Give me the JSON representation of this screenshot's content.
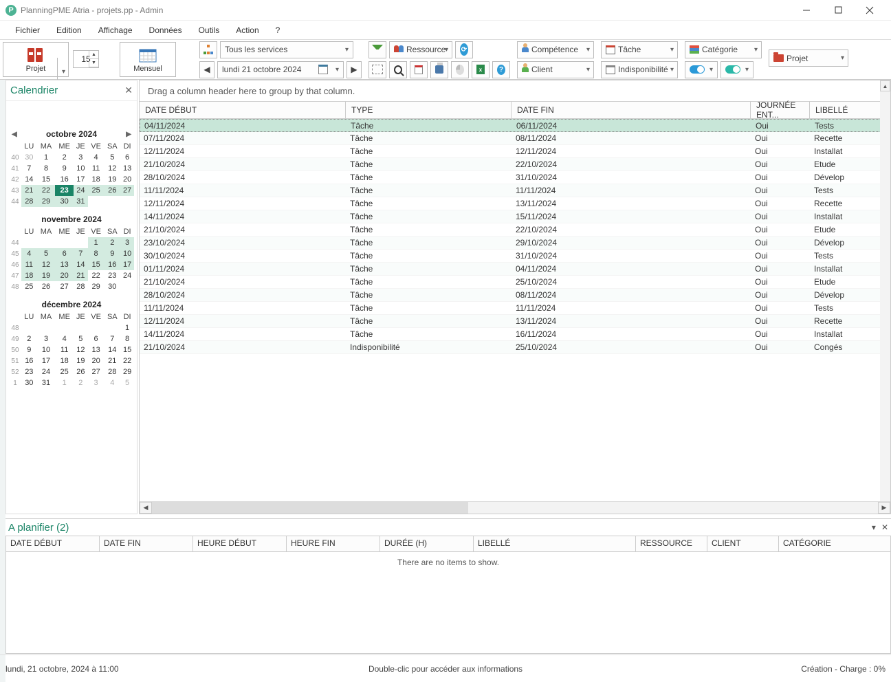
{
  "title": "PlanningPME Atria - projets.pp - Admin",
  "menu": [
    "Fichier",
    "Edition",
    "Affichage",
    "Données",
    "Outils",
    "Action",
    "?"
  ],
  "toolbar": {
    "projet": "Projet",
    "mensuel": "Mensuel",
    "num": "15",
    "service_combo": "Tous les services",
    "date_display": "lundi     21   octobre   2024",
    "ressource": "Ressource",
    "competence": "Compétence",
    "tache": "Tâche",
    "categorie": "Catégorie",
    "projet2": "Projet",
    "client": "Client",
    "indispo": "Indisponibilité"
  },
  "calendar_panel": {
    "title": "Calendrier",
    "months": [
      {
        "name": "octobre 2024",
        "nav": true,
        "dow": [
          "LU",
          "MA",
          "ME",
          "JE",
          "VE",
          "SA",
          "DI"
        ],
        "rows": [
          {
            "wk": "40",
            "days": [
              {
                "d": "30",
                "cls": "out"
              },
              {
                "d": "1"
              },
              {
                "d": "2"
              },
              {
                "d": "3"
              },
              {
                "d": "4"
              },
              {
                "d": "5"
              },
              {
                "d": "6"
              }
            ]
          },
          {
            "wk": "41",
            "days": [
              {
                "d": "7"
              },
              {
                "d": "8"
              },
              {
                "d": "9"
              },
              {
                "d": "10"
              },
              {
                "d": "11"
              },
              {
                "d": "12"
              },
              {
                "d": "13"
              }
            ]
          },
          {
            "wk": "42",
            "days": [
              {
                "d": "14"
              },
              {
                "d": "15"
              },
              {
                "d": "16"
              },
              {
                "d": "17"
              },
              {
                "d": "18"
              },
              {
                "d": "19"
              },
              {
                "d": "20"
              }
            ]
          },
          {
            "wk": "43",
            "days": [
              {
                "d": "21",
                "cls": "hl"
              },
              {
                "d": "22",
                "cls": "hl"
              },
              {
                "d": "23",
                "cls": "today"
              },
              {
                "d": "24",
                "cls": "hl"
              },
              {
                "d": "25",
                "cls": "hl"
              },
              {
                "d": "26",
                "cls": "hl"
              },
              {
                "d": "27",
                "cls": "hl"
              }
            ]
          },
          {
            "wk": "44",
            "days": [
              {
                "d": "28",
                "cls": "hl"
              },
              {
                "d": "29",
                "cls": "hl"
              },
              {
                "d": "30",
                "cls": "hl"
              },
              {
                "d": "31",
                "cls": "hl"
              },
              {
                "d": ""
              },
              {
                "d": ""
              },
              {
                "d": ""
              }
            ]
          }
        ]
      },
      {
        "name": "novembre 2024",
        "nav": false,
        "dow": [
          "LU",
          "MA",
          "ME",
          "JE",
          "VE",
          "SA",
          "DI"
        ],
        "rows": [
          {
            "wk": "44",
            "days": [
              {
                "d": ""
              },
              {
                "d": ""
              },
              {
                "d": ""
              },
              {
                "d": ""
              },
              {
                "d": "1",
                "cls": "hl"
              },
              {
                "d": "2",
                "cls": "hl"
              },
              {
                "d": "3",
                "cls": "hl"
              }
            ]
          },
          {
            "wk": "45",
            "days": [
              {
                "d": "4",
                "cls": "hl"
              },
              {
                "d": "5",
                "cls": "hl"
              },
              {
                "d": "6",
                "cls": "hl"
              },
              {
                "d": "7",
                "cls": "hl"
              },
              {
                "d": "8",
                "cls": "hl"
              },
              {
                "d": "9",
                "cls": "hl"
              },
              {
                "d": "10",
                "cls": "hl"
              }
            ]
          },
          {
            "wk": "46",
            "days": [
              {
                "d": "11",
                "cls": "hl"
              },
              {
                "d": "12",
                "cls": "hl"
              },
              {
                "d": "13",
                "cls": "hl"
              },
              {
                "d": "14",
                "cls": "hl"
              },
              {
                "d": "15",
                "cls": "hl"
              },
              {
                "d": "16",
                "cls": "hl"
              },
              {
                "d": "17",
                "cls": "hl"
              }
            ]
          },
          {
            "wk": "47",
            "days": [
              {
                "d": "18",
                "cls": "hl"
              },
              {
                "d": "19",
                "cls": "hl"
              },
              {
                "d": "20",
                "cls": "hl"
              },
              {
                "d": "21",
                "cls": "hl"
              },
              {
                "d": "22"
              },
              {
                "d": "23"
              },
              {
                "d": "24"
              }
            ]
          },
          {
            "wk": "48",
            "days": [
              {
                "d": "25"
              },
              {
                "d": "26"
              },
              {
                "d": "27"
              },
              {
                "d": "28"
              },
              {
                "d": "29"
              },
              {
                "d": "30"
              },
              {
                "d": ""
              }
            ]
          }
        ]
      },
      {
        "name": "décembre 2024",
        "nav": false,
        "dow": [
          "LU",
          "MA",
          "ME",
          "JE",
          "VE",
          "SA",
          "DI"
        ],
        "rows": [
          {
            "wk": "48",
            "days": [
              {
                "d": ""
              },
              {
                "d": ""
              },
              {
                "d": ""
              },
              {
                "d": ""
              },
              {
                "d": ""
              },
              {
                "d": ""
              },
              {
                "d": "1"
              }
            ]
          },
          {
            "wk": "49",
            "days": [
              {
                "d": "2"
              },
              {
                "d": "3"
              },
              {
                "d": "4"
              },
              {
                "d": "5"
              },
              {
                "d": "6"
              },
              {
                "d": "7"
              },
              {
                "d": "8"
              }
            ]
          },
          {
            "wk": "50",
            "days": [
              {
                "d": "9"
              },
              {
                "d": "10"
              },
              {
                "d": "11"
              },
              {
                "d": "12"
              },
              {
                "d": "13"
              },
              {
                "d": "14"
              },
              {
                "d": "15"
              }
            ]
          },
          {
            "wk": "51",
            "days": [
              {
                "d": "16"
              },
              {
                "d": "17"
              },
              {
                "d": "18"
              },
              {
                "d": "19"
              },
              {
                "d": "20"
              },
              {
                "d": "21"
              },
              {
                "d": "22"
              }
            ]
          },
          {
            "wk": "52",
            "days": [
              {
                "d": "23"
              },
              {
                "d": "24"
              },
              {
                "d": "25"
              },
              {
                "d": "26"
              },
              {
                "d": "27"
              },
              {
                "d": "28"
              },
              {
                "d": "29"
              }
            ]
          },
          {
            "wk": "1",
            "days": [
              {
                "d": "30"
              },
              {
                "d": "31"
              },
              {
                "d": "1",
                "cls": "out"
              },
              {
                "d": "2",
                "cls": "out"
              },
              {
                "d": "3",
                "cls": "out"
              },
              {
                "d": "4",
                "cls": "out"
              },
              {
                "d": "5",
                "cls": "out"
              }
            ]
          }
        ]
      }
    ]
  },
  "grid": {
    "hint": "Drag a column header here to group by that column.",
    "columns": [
      "DATE DÉBUT",
      "TYPE",
      "DATE FIN",
      "JOURNÉE ENT...",
      "LIBELLÉ"
    ],
    "rows": [
      {
        "sel": true,
        "cells": [
          "04/11/2024",
          "Tâche",
          "06/11/2024",
          "Oui",
          "Tests"
        ]
      },
      {
        "cells": [
          "07/11/2024",
          "Tâche",
          "08/11/2024",
          "Oui",
          "Recette"
        ]
      },
      {
        "cells": [
          "12/11/2024",
          "Tâche",
          "12/11/2024",
          "Oui",
          "Installat"
        ]
      },
      {
        "cells": [
          "21/10/2024",
          "Tâche",
          "22/10/2024",
          "Oui",
          "Etude"
        ]
      },
      {
        "cells": [
          "28/10/2024",
          "Tâche",
          "31/10/2024",
          "Oui",
          "Dévelop"
        ]
      },
      {
        "cells": [
          "11/11/2024",
          "Tâche",
          "11/11/2024",
          "Oui",
          "Tests"
        ]
      },
      {
        "cells": [
          "12/11/2024",
          "Tâche",
          "13/11/2024",
          "Oui",
          "Recette"
        ]
      },
      {
        "cells": [
          "14/11/2024",
          "Tâche",
          "15/11/2024",
          "Oui",
          "Installat"
        ]
      },
      {
        "cells": [
          "21/10/2024",
          "Tâche",
          "22/10/2024",
          "Oui",
          "Etude"
        ]
      },
      {
        "cells": [
          "23/10/2024",
          "Tâche",
          "29/10/2024",
          "Oui",
          "Dévelop"
        ]
      },
      {
        "cells": [
          "30/10/2024",
          "Tâche",
          "31/10/2024",
          "Oui",
          "Tests"
        ]
      },
      {
        "cells": [
          "01/11/2024",
          "Tâche",
          "04/11/2024",
          "Oui",
          "Installat"
        ]
      },
      {
        "cells": [
          "21/10/2024",
          "Tâche",
          "25/10/2024",
          "Oui",
          "Etude"
        ]
      },
      {
        "cells": [
          "28/10/2024",
          "Tâche",
          "08/11/2024",
          "Oui",
          "Dévelop"
        ]
      },
      {
        "cells": [
          "11/11/2024",
          "Tâche",
          "11/11/2024",
          "Oui",
          "Tests"
        ]
      },
      {
        "cells": [
          "12/11/2024",
          "Tâche",
          "13/11/2024",
          "Oui",
          "Recette"
        ]
      },
      {
        "cells": [
          "14/11/2024",
          "Tâche",
          "16/11/2024",
          "Oui",
          "Installat"
        ]
      },
      {
        "cells": [
          "21/10/2024",
          "Indisponibilité",
          "25/10/2024",
          "Oui",
          "Congés"
        ]
      }
    ]
  },
  "bottom": {
    "title": "A planifier (2)",
    "columns": [
      "DATE DÉBUT",
      "DATE FIN",
      "HEURE DÉBUT",
      "HEURE FIN",
      "DURÉE (H)",
      "LIBELLÉ",
      "RESSOURCE",
      "CLIENT",
      "CATÉGORIE"
    ],
    "empty": "There are no items to show."
  },
  "status": {
    "left": "lundi, 21 octobre, 2024 à 11:00",
    "mid": "Double-clic pour accéder aux informations",
    "right": "Création - Charge : 0%"
  }
}
